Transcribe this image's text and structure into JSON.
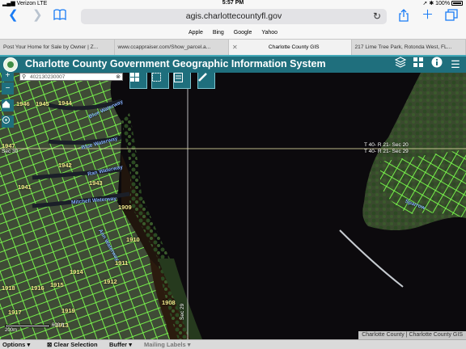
{
  "status_bar": {
    "carrier": "Verizon",
    "network": "LTE",
    "time": "5:57 PM",
    "battery": "100%"
  },
  "browser": {
    "url": "agis.charlottecountyfl.gov",
    "favorites": [
      "Apple",
      "Bing",
      "Google",
      "Yahoo"
    ],
    "tabs": [
      {
        "title": "Post Your Home for Sale by Owner | Z...",
        "active": false
      },
      {
        "title": "www.ccappraiser.com/Show_parcel.a...",
        "active": false
      },
      {
        "title": "Charlotte County GIS",
        "active": true
      },
      {
        "title": "217 Lime Tree Park, Rotonda West, FL...",
        "active": false
      }
    ]
  },
  "gis": {
    "title": "Charlotte County Government Geographic Information System",
    "search_value": "402130230007",
    "parcel_labels": [
      "1946",
      "1945",
      "1944",
      "1947",
      "1942",
      "1943",
      "1941",
      "1909",
      "1910",
      "1911",
      "1914",
      "1912",
      "1915",
      "1918",
      "1916",
      "1917",
      "1919",
      "1913",
      "1908"
    ],
    "street_labels": [
      "Blue Waterway",
      "Ran Waterway",
      "Mitchell Waterway",
      "Ann Waterway",
      "Sparrow"
    ],
    "section_labels": [
      "T 40- R 21- Sec 20",
      "T 40- R 21- Sec 29",
      "T 40- R 21- Sec 30"
    ],
    "section_labels_short": [
      "Sec 30",
      "Sec 29"
    ],
    "scale_label": "600 ft",
    "scale_label_2": "200m",
    "attribution": "Charlotte County | Charlotte County GIS"
  },
  "bottom_bar": {
    "options_label": "Options",
    "clear_selection_label": "Clear Selection",
    "buffer_label": "Buffer",
    "mailing_labels_label": "Mailing Labels"
  }
}
